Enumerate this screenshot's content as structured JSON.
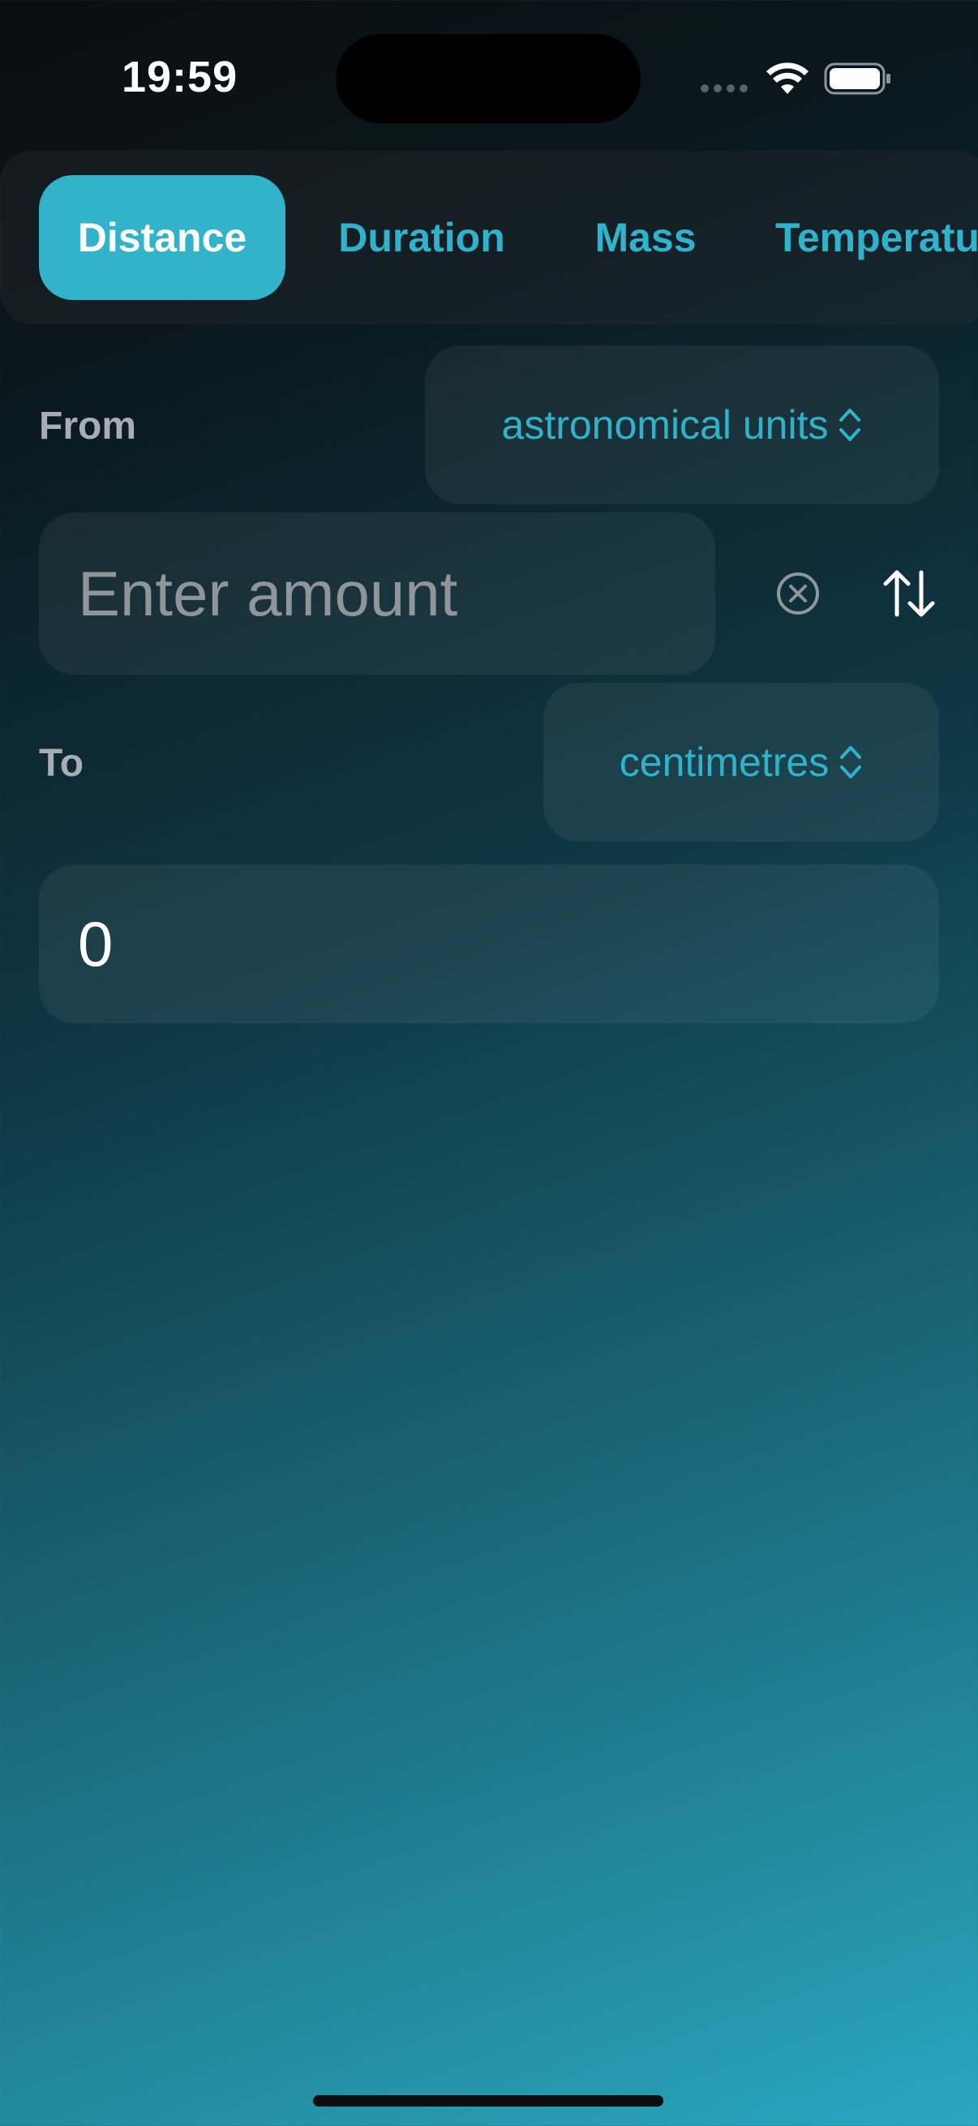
{
  "status_bar": {
    "time": "19:59"
  },
  "tabs": [
    {
      "label": "Distance",
      "selected": true
    },
    {
      "label": "Duration",
      "selected": false
    },
    {
      "label": "Mass",
      "selected": false
    },
    {
      "label": "Temperatu",
      "selected": false
    }
  ],
  "from": {
    "label": "From",
    "unit": "astronomical units",
    "amount_placeholder": "Enter amount",
    "amount_value": ""
  },
  "to": {
    "label": "To",
    "unit": "centimetres",
    "result": "0"
  },
  "colors": {
    "accent": "#32b3c9",
    "accent_text": "#2fb3cb",
    "label_gray": "#a7adb2",
    "placeholder_gray": "#8f9599"
  },
  "icons": {
    "unit_picker": "chevrons-up-down-icon",
    "clear": "clear-circle-icon",
    "swap": "swap-arrows-icon"
  }
}
